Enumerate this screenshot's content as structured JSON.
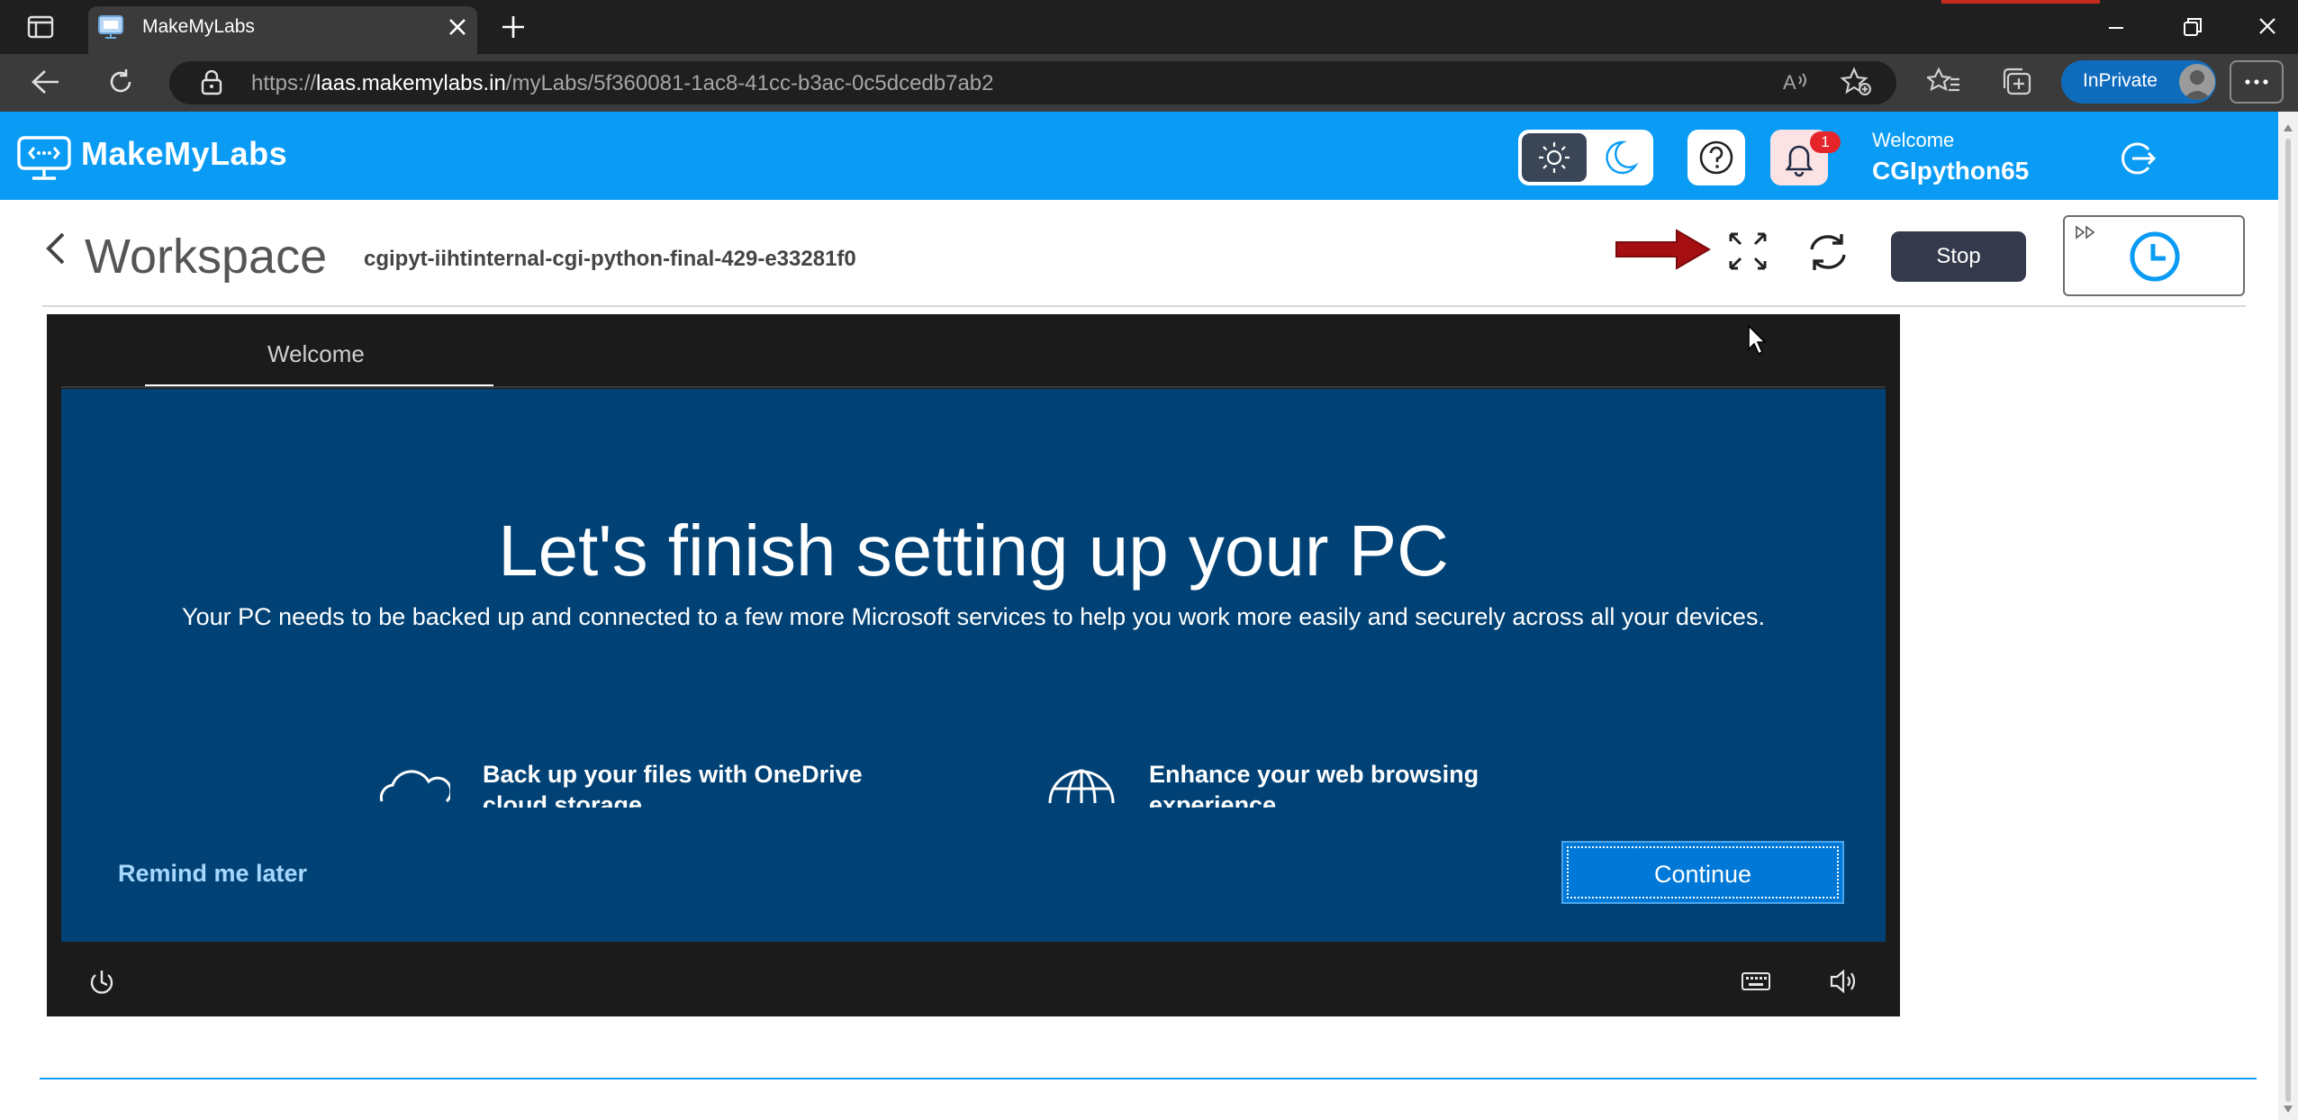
{
  "browser": {
    "tab_title": "MakeMyLabs",
    "url_prefix": "https://",
    "url_host": "laas.makemylabs.in",
    "url_path": "/myLabs/5f360081-1ac8-41cc-b3ac-0c5dcedb7ab2",
    "inprivate_label": "InPrivate"
  },
  "app": {
    "logo_text": "MakeMyLabs",
    "notification_count": "1",
    "welcome_label": "Welcome",
    "username": "CGIpython65"
  },
  "workspace": {
    "title": "Workspace",
    "lab_id": "cgipyt-iihtinternal-cgi-python-final-429-e33281f0",
    "stop_label": "Stop"
  },
  "vm": {
    "tab_label": "Welcome",
    "heading": "Let's finish setting up your PC",
    "subheading": "Your PC needs to be backed up and connected to a few more Microsoft services to help you work more easily and securely across all your devices.",
    "features": [
      {
        "icon": "cloud-icon",
        "text": "Back up your files with OneDrive cloud storage"
      },
      {
        "icon": "globe-icon",
        "text": "Enhance your web browsing experience"
      }
    ],
    "remind_label": "Remind me later",
    "continue_label": "Continue"
  },
  "colors": {
    "header_blue": "#0a9cf5",
    "oobe_blue": "#004275",
    "stop_button": "#343a4b",
    "annotation_arrow": "#a50f12"
  }
}
